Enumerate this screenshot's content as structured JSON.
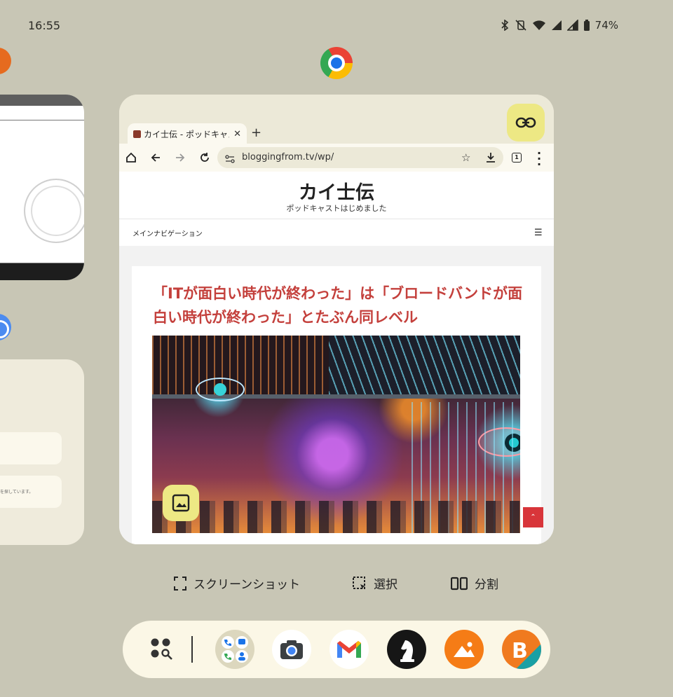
{
  "status_bar": {
    "time": "16:55",
    "battery": "74%"
  },
  "main_app": {
    "icon": "chrome-icon",
    "tab_title": "カイ士伝 - ポッドキャス",
    "url": "bloggingfrom.tv/wp/",
    "tab_count": "1"
  },
  "site": {
    "title": "カイ士伝",
    "tagline": "ポッドキャストはじめました",
    "nav_label": "メインナビゲーション",
    "post_title": "「ITが面白い時代が終わった」は「ブロードバンドが面白い時代が終わった」とたぶん同レベル"
  },
  "left_cards": {
    "mid_snippet": "を探しています。"
  },
  "actions": {
    "screenshot": "スクリーンショット",
    "select": "選択",
    "split": "分割"
  },
  "dock": {
    "items": [
      "apps-search-icon",
      "folder-icon",
      "camera-icon",
      "gmail-icon",
      "chess-icon",
      "gallery-icon",
      "bplus-icon"
    ]
  },
  "colors": {
    "background": "#c8c6b5",
    "accent_yellow": "#ede884",
    "post_title_red": "#c4403c"
  }
}
